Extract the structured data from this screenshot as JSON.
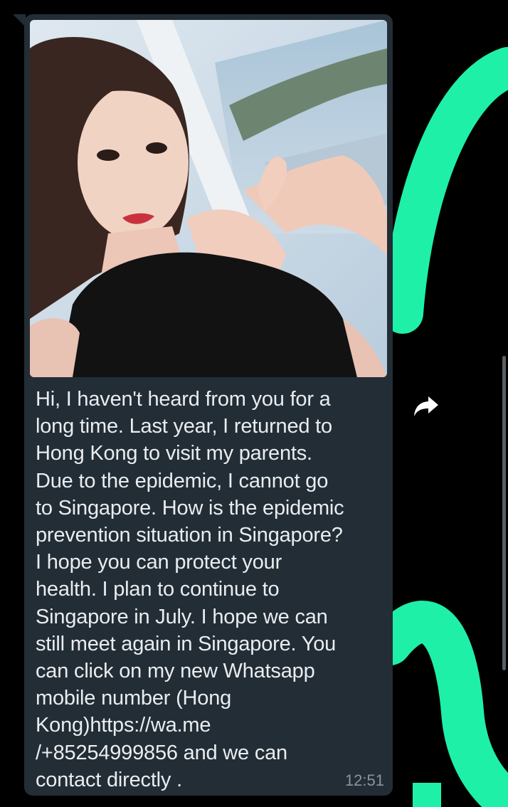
{
  "colors": {
    "background": "#000000",
    "bubble": "#232d36",
    "message_text": "#e9edef",
    "timestamp": "#8696a0",
    "wallpaper_accent": "#1ef0a8"
  },
  "icons": {
    "forward": "forward-icon"
  },
  "message": {
    "text": "Hi, I haven't heard from you for a\nlong time. Last year, I returned to\nHong Kong to visit my parents.\nDue to the epidemic, I cannot go\nto Singapore. How is the epidemic\nprevention situation in Singapore?\nI hope you can protect your\nhealth. I plan to continue to\nSingapore in July. I hope we can\nstill meet again in Singapore. You\ncan click on my new Whatsapp\nmobile number (Hong\nKong)https://wa.me\n/+85254999856 and we can\ncontact directly .",
    "time": "12:51"
  }
}
